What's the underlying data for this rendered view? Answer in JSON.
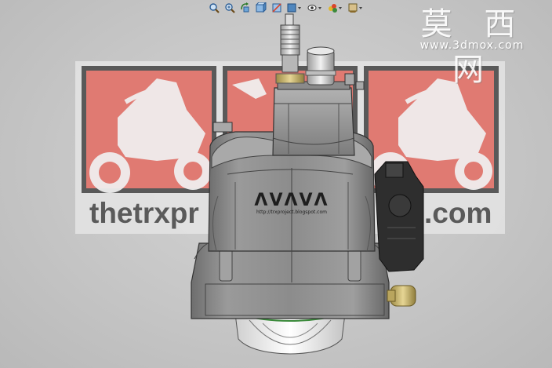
{
  "watermark": {
    "site_name": "莫 西 网",
    "site_url": "www.3dmox.com"
  },
  "banner": {
    "text_left": "thetrxpr",
    "text_right": ".com"
  },
  "engine": {
    "logo_text": "ΛVΛVΛ",
    "logo_url": "http://trxproject.blogspot.com"
  },
  "toolbar": {
    "tools": [
      {
        "id": "zoom-fit",
        "icon": "zoom-fit-icon"
      },
      {
        "id": "zoom-area",
        "icon": "zoom-area-icon"
      },
      {
        "id": "rotate",
        "icon": "rotate-view-icon"
      },
      {
        "id": "view-orientation",
        "icon": "view-orientation-icon"
      },
      {
        "id": "section-view",
        "icon": "section-view-icon"
      },
      {
        "id": "display-style",
        "icon": "display-style-icon"
      },
      {
        "id": "hide-show",
        "icon": "hide-show-icon"
      },
      {
        "id": "appearance",
        "icon": "appearance-icon"
      },
      {
        "id": "scene",
        "icon": "scene-icon"
      }
    ]
  },
  "colors": {
    "background": "#c6c6c6",
    "banner_red": "#e07a72",
    "banner_text": "#5a5a5a",
    "engine_body": "#8f8f8f",
    "ignition_module": "#2e2e2e",
    "brass_fitting": "#c8b46a"
  }
}
